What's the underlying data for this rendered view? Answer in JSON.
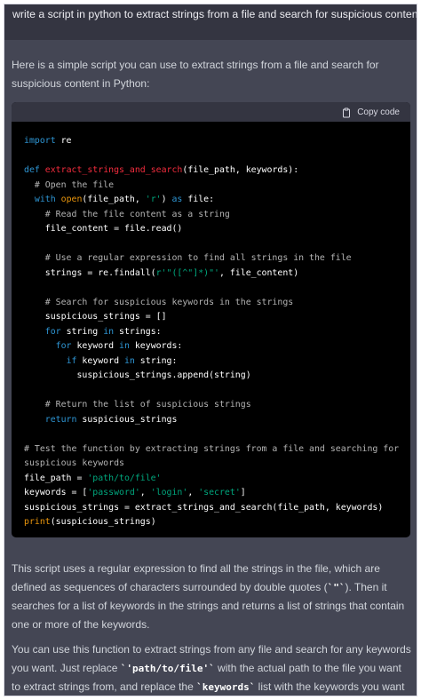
{
  "user_message": "write a script in python to extract strings from a file and search for suspicious content",
  "assistant": {
    "intro": "Here is a simple script you can use to extract strings from a file and search for suspicious content in Python:",
    "code_block": {
      "copy_label": "Copy code",
      "copy_icon": "clipboard-icon",
      "language": "python",
      "lines": [
        [
          {
            "t": "import",
            "c": "kw"
          },
          {
            "t": " re"
          }
        ],
        [],
        [
          {
            "t": "def",
            "c": "kw"
          },
          {
            "t": " "
          },
          {
            "t": "extract_strings_and_search",
            "c": "fn"
          },
          {
            "t": "(file_path, keywords):"
          }
        ],
        [
          {
            "t": "  "
          },
          {
            "t": "# Open the file",
            "c": "cm"
          }
        ],
        [
          {
            "t": "  "
          },
          {
            "t": "with",
            "c": "kw"
          },
          {
            "t": " "
          },
          {
            "t": "open",
            "c": "bi"
          },
          {
            "t": "(file_path, "
          },
          {
            "t": "'r'",
            "c": "str"
          },
          {
            "t": ") "
          },
          {
            "t": "as",
            "c": "kw"
          },
          {
            "t": " file:"
          }
        ],
        [
          {
            "t": "    "
          },
          {
            "t": "# Read the file content as a string",
            "c": "cm"
          }
        ],
        [
          {
            "t": "    file_content = file.read()"
          }
        ],
        [],
        [
          {
            "t": "    "
          },
          {
            "t": "# Use a regular expression to find all strings in the file",
            "c": "cm"
          }
        ],
        [
          {
            "t": "    strings = re.findall("
          },
          {
            "t": "r'\"([^\"]*)\"'",
            "c": "str"
          },
          {
            "t": ", file_content)"
          }
        ],
        [],
        [
          {
            "t": "    "
          },
          {
            "t": "# Search for suspicious keywords in the strings",
            "c": "cm"
          }
        ],
        [
          {
            "t": "    suspicious_strings = []"
          }
        ],
        [
          {
            "t": "    "
          },
          {
            "t": "for",
            "c": "kw"
          },
          {
            "t": " string "
          },
          {
            "t": "in",
            "c": "kw"
          },
          {
            "t": " strings:"
          }
        ],
        [
          {
            "t": "      "
          },
          {
            "t": "for",
            "c": "kw"
          },
          {
            "t": " keyword "
          },
          {
            "t": "in",
            "c": "kw"
          },
          {
            "t": " keywords:"
          }
        ],
        [
          {
            "t": "        "
          },
          {
            "t": "if",
            "c": "kw"
          },
          {
            "t": " keyword "
          },
          {
            "t": "in",
            "c": "kw"
          },
          {
            "t": " string:"
          }
        ],
        [
          {
            "t": "          suspicious_strings.append(string)"
          }
        ],
        [],
        [
          {
            "t": "    "
          },
          {
            "t": "# Return the list of suspicious strings",
            "c": "cm"
          }
        ],
        [
          {
            "t": "    "
          },
          {
            "t": "return",
            "c": "kw"
          },
          {
            "t": " suspicious_strings"
          }
        ],
        [],
        [
          {
            "t": "# Test the function by extracting strings from a file and searching for",
            "c": "cm"
          }
        ],
        [
          {
            "t": "suspicious keywords",
            "c": "cm"
          }
        ],
        [
          {
            "t": "file_path = "
          },
          {
            "t": "'path/to/file'",
            "c": "str"
          }
        ],
        [
          {
            "t": "keywords = ["
          },
          {
            "t": "'password'",
            "c": "str"
          },
          {
            "t": ", "
          },
          {
            "t": "'login'",
            "c": "str"
          },
          {
            "t": ", "
          },
          {
            "t": "'secret'",
            "c": "str"
          },
          {
            "t": "]"
          }
        ],
        [
          {
            "t": "suspicious_strings = extract_strings_and_search(file_path, keywords)"
          }
        ],
        [
          {
            "t": "print",
            "c": "bi"
          },
          {
            "t": "(suspicious_strings)"
          }
        ]
      ]
    },
    "paragraph1": [
      {
        "t": "This script uses a regular expression to find all the strings in the file, which are defined as sequences of characters surrounded by double quotes ("
      },
      {
        "t": "`\"`",
        "code": true
      },
      {
        "t": "). Then it searches for a list of keywords in the strings and returns a list of strings that contain one or more of the keywords."
      }
    ],
    "paragraph2": [
      {
        "t": "You can use this function to extract strings from any file and search for any keywords you want. Just replace "
      },
      {
        "t": "`'path/to/file'`",
        "code": true
      },
      {
        "t": " with the actual path to the file you want to extract strings from, and replace the "
      },
      {
        "t": "`keywords`",
        "code": true
      },
      {
        "t": " list with the keywords you want to search for."
      }
    ]
  },
  "colors": {
    "user_bg": "#343541",
    "assistant_bg": "#444654",
    "code_bg": "#000000",
    "keyword": "#2e95d3",
    "function_name": "#f22c3d",
    "string": "#00a67d",
    "comment": "#b3b3b3",
    "builtin": "#e9950c"
  }
}
